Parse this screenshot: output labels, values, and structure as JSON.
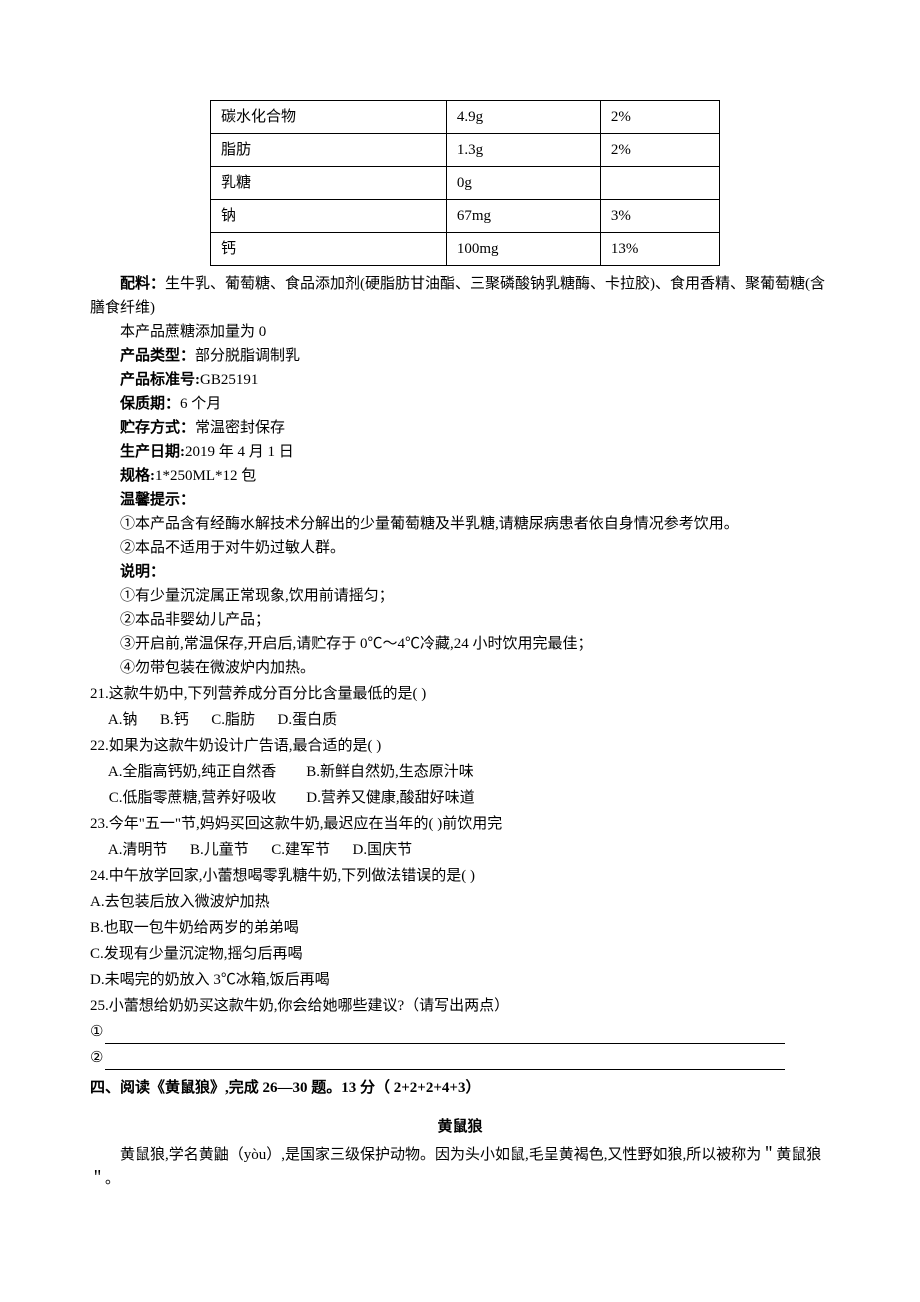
{
  "table": {
    "rows": [
      {
        "name": "碳水化合物",
        "amount": "4.9g",
        "pct": "2%"
      },
      {
        "name": "脂肪",
        "amount": "1.3g",
        "pct": "2%"
      },
      {
        "name": "乳糖",
        "amount": "0g",
        "pct": ""
      },
      {
        "name": "钠",
        "amount": "67mg",
        "pct": "3%"
      },
      {
        "name": "钙",
        "amount": "100mg",
        "pct": "13%"
      }
    ]
  },
  "ingredients": {
    "label": "配料：",
    "text": "生牛乳、葡萄糖、食品添加剂(硬脂肪甘油酯、三聚磷酸钠乳糖酶、卡拉胶)、食用香精、聚葡萄糖(含膳食纤维)"
  },
  "sucrose_line": "本产品蔗糖添加量为 0",
  "productType": {
    "label": "产品类型：",
    "text": "部分脱脂调制乳"
  },
  "standard": {
    "label": "产品标准号:",
    "text": "GB25191"
  },
  "shelfLife": {
    "label": "保质期：",
    "text": "6 个月"
  },
  "storage": {
    "label": "贮存方式：",
    "text": "常温密封保存"
  },
  "prodDate": {
    "label": "生产日期:",
    "text": "2019 年 4 月 1 日"
  },
  "spec": {
    "label": "规格:",
    "text": "1*250ML*12 包"
  },
  "tipsLabel": "温馨提示：",
  "tip1": "①本产品含有经酶水解技术分解出的少量葡萄糖及半乳糖,请糖尿病患者依自身情况参考饮用。",
  "tip2": "②本品不适用于对牛奶过敏人群。",
  "notesLabel": "说明：",
  "note1": "①有少量沉淀属正常现象,饮用前请摇匀；",
  "note2": "②本品非婴幼儿产品；",
  "note3": "③开启前,常温保存,开启后,请贮存于 0℃～4℃冷藏,24 小时饮用完最佳；",
  "note4": "④勿带包装在微波炉内加热。",
  "q21": {
    "stem": "21.这款牛奶中,下列营养成分百分比含量最低的是(      )",
    "opts": " A.钠      B.钙      C.脂肪      D.蛋白质"
  },
  "q22": {
    "stem": "22.如果为这款牛奶设计广告语,最合适的是(      )",
    "optA": " A.全脂高钙奶,纯正自然香        B.新鲜自然奶,生态原汁味",
    "optB": " C.低脂零蔗糖,营养好吸收        D.营养又健康,酸甜好味道"
  },
  "q23": {
    "stem": "23.今年\"五一\"节,妈妈买回这款牛奶,最迟应在当年的(      )前饮用完",
    "opts": " A.清明节      B.儿童节      C.建军节      D.国庆节"
  },
  "q24": {
    "stem": "24.中午放学回家,小蕾想喝零乳糖牛奶,下列做法错误的是(      )",
    "a": " A.去包装后放入微波炉加热",
    "b": " B.也取一包牛奶给两岁的弟弟喝",
    "c": " C.发现有少量沉淀物,摇匀后再喝",
    "d": " D.未喝完的奶放入 3℃冰箱,饭后再喝"
  },
  "q25": {
    "stem": "25.小蕾想给奶奶买这款牛奶,你会给她哪些建议?（请写出两点）",
    "l1": "①",
    "l2": "②"
  },
  "section4": "四、阅读《黄鼠狼》,完成 26—30 题。13 分（ 2+2+2+4+3）",
  "passageTitle": "黄鼠狼",
  "passagePara": "黄鼠狼,学名黄鼬（yòu）,是国家三级保护动物。因为头小如鼠,毛呈黄褐色,又性野如狼,所以被称为＂黄鼠狼＂。"
}
